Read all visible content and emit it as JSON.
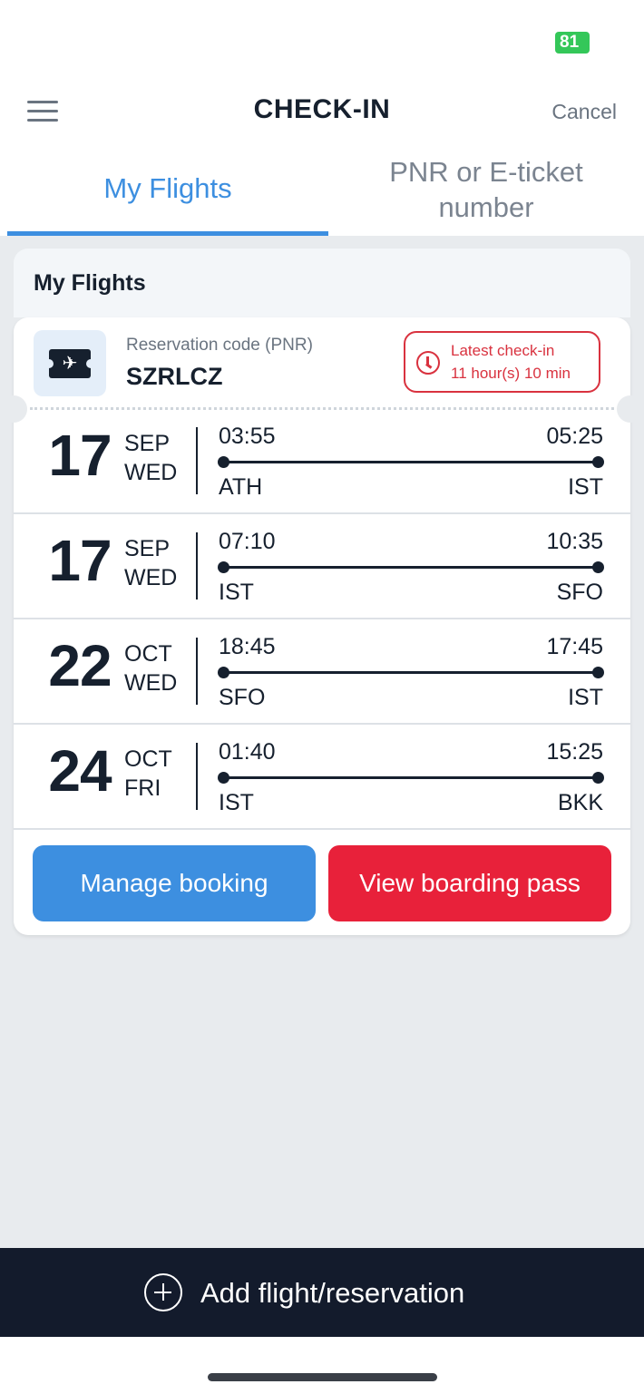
{
  "status_bar": {
    "battery": "81"
  },
  "header": {
    "title": "CHECK-IN",
    "cancel_label": "Cancel"
  },
  "tabs": [
    {
      "label": "My Flights",
      "active": true
    },
    {
      "label": "PNR or E-ticket number",
      "line1": "PNR or E-ticket",
      "line2": "number",
      "active": false
    }
  ],
  "section": {
    "title": "My Flights"
  },
  "reservation": {
    "label": "Reservation code (PNR)",
    "code": "SZRLCZ",
    "checkin_badge": {
      "line1": "Latest check-in",
      "line2": "11 hour(s) 10 min"
    }
  },
  "segments": [
    {
      "day": "17",
      "month": "SEP",
      "weekday": "WED",
      "dep_time": "03:55",
      "arr_time": "05:25",
      "from": "ATH",
      "to": "IST"
    },
    {
      "day": "17",
      "month": "SEP",
      "weekday": "WED",
      "dep_time": "07:10",
      "arr_time": "10:35",
      "from": "IST",
      "to": "SFO"
    },
    {
      "day": "22",
      "month": "OCT",
      "weekday": "WED",
      "dep_time": "18:45",
      "arr_time": "17:45",
      "from": "SFO",
      "to": "IST"
    },
    {
      "day": "24",
      "month": "OCT",
      "weekday": "FRI",
      "dep_time": "01:40",
      "arr_time": "15:25",
      "from": "IST",
      "to": "BKK"
    }
  ],
  "actions": {
    "manage_booking": "Manage booking",
    "view_boarding_pass": "View boarding pass"
  },
  "bottom": {
    "add_label": "Add flight/reservation"
  },
  "colors": {
    "accent_blue": "#3d8fe0",
    "accent_red": "#e8213a",
    "dark_navy": "#131b2c",
    "battery_green": "#34c759"
  },
  "icons": [
    "menu-icon",
    "ticket-icon",
    "clock-icon",
    "plus-circle-icon"
  ]
}
